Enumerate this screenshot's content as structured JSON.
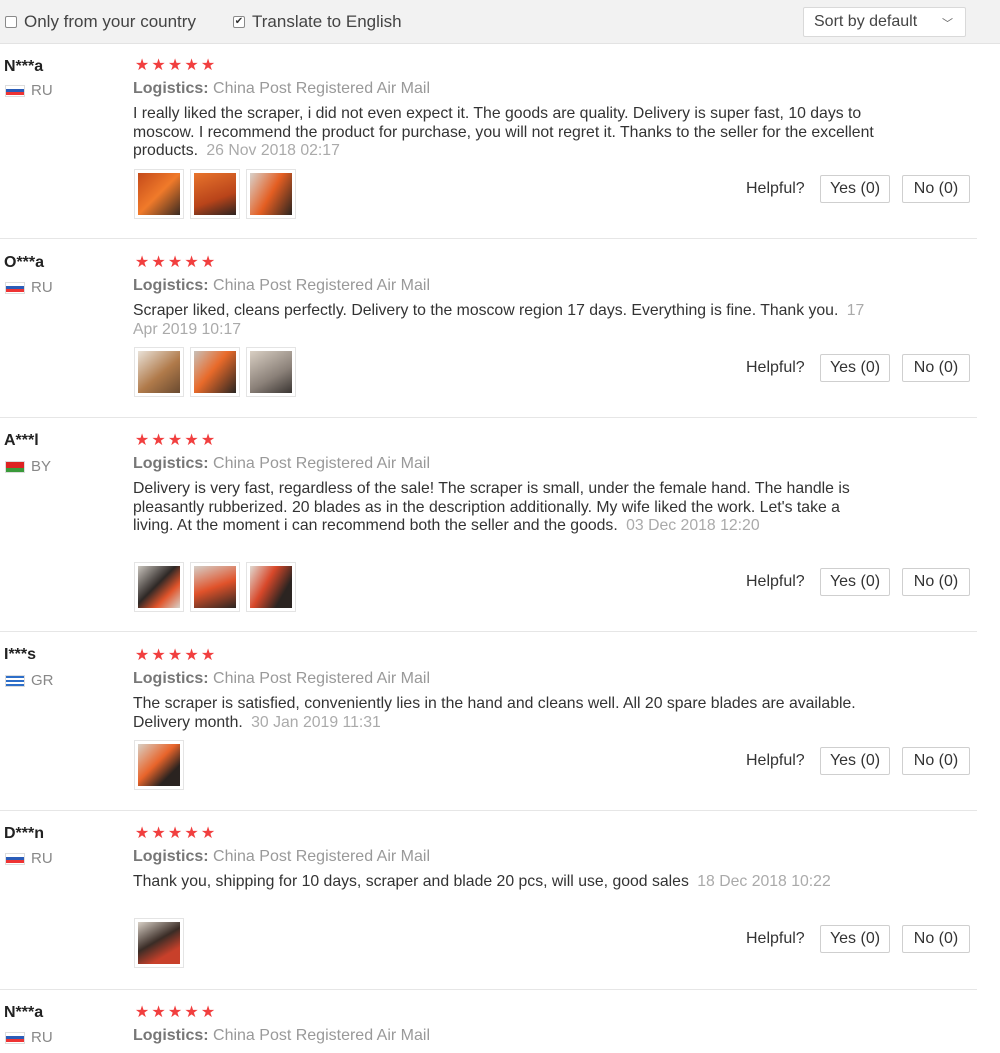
{
  "filters": {
    "only_country_label": "Only from your country",
    "only_country_checked": false,
    "translate_label": "Translate to English",
    "translate_checked": true,
    "sort_label": "Sort by default"
  },
  "labels": {
    "logistics_prefix": "Logistics:",
    "helpful": "Helpful?"
  },
  "colors": {
    "star": "#f13f3f",
    "date": "#aaaaaa"
  },
  "reviews": [
    {
      "user": "N***a",
      "country": "RU",
      "rating": 5,
      "logistics": "China Post Registered Air Mail",
      "text": "I really liked the scraper, i did not even expect it. The goods are quality. Delivery is super fast, 10 days to moscow. I recommend the product for purchase, you will not regret it. Thanks to the seller for the excellent products.",
      "date": "26 Nov 2018 02:17",
      "photos": 3,
      "yes": "Yes (0)",
      "no": "No (0)"
    },
    {
      "user": "O***a",
      "country": "RU",
      "rating": 5,
      "logistics": "China Post Registered Air Mail",
      "text": "Scraper liked, cleans perfectly. Delivery to the moscow region 17 days. Everything is fine. Thank you.",
      "date": "17 Apr 2019 10:17",
      "photos": 3,
      "yes": "Yes (0)",
      "no": "No (0)"
    },
    {
      "user": "A***l",
      "country": "BY",
      "rating": 5,
      "logistics": "China Post Registered Air Mail",
      "text": "Delivery is very fast, regardless of the sale! The scraper is small, under the female hand. The handle is pleasantly rubberized. 20 blades as in the description additionally. My wife liked the work. Let's take a living. At the moment i can recommend both the seller and the goods.",
      "date": "03 Dec 2018 12:20",
      "photos": 3,
      "yes": "Yes (0)",
      "no": "No (0)"
    },
    {
      "user": "I***s",
      "country": "GR",
      "rating": 5,
      "logistics": "China Post Registered Air Mail",
      "text": "The scraper is satisfied, conveniently lies in the hand and cleans well. All 20 spare blades are available. Delivery month.",
      "date": "30 Jan 2019 11:31",
      "photos": 1,
      "yes": "Yes (0)",
      "no": "No (0)"
    },
    {
      "user": "D***n",
      "country": "RU",
      "rating": 5,
      "logistics": "China Post Registered Air Mail",
      "text": "Thank you, shipping for 10 days, scraper and blade 20 pcs, will use, good sales",
      "date": "18 Dec 2018 10:22",
      "photos": 1,
      "yes": "Yes (0)",
      "no": "No (0)"
    },
    {
      "user": "N***a",
      "country": "RU",
      "rating": 5,
      "logistics": "China Post Registered Air Mail"
    }
  ]
}
